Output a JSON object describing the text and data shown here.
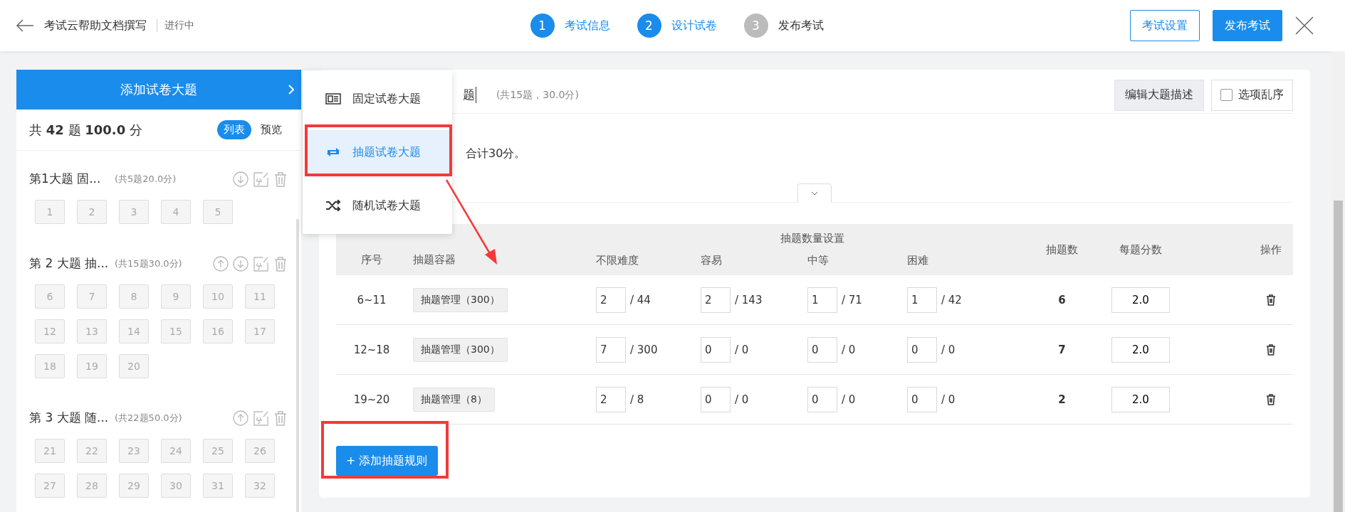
{
  "header": {
    "title": "考试云帮助文档撰写",
    "status": "进行中",
    "steps": [
      {
        "number": "1",
        "label": "考试信息",
        "reached": true
      },
      {
        "number": "2",
        "label": "设计试卷",
        "reached": true
      },
      {
        "number": "3",
        "label": "发布考试",
        "reached": false
      }
    ],
    "buttons": [
      {
        "label": "考试设置",
        "kind": "outline"
      },
      {
        "label": "发布考试",
        "kind": "primary"
      }
    ]
  },
  "sidebar": {
    "add_label": "添加试卷大题",
    "summary": "共 **42** 题 **100.0** 分",
    "view_tabs": [
      {
        "label": "列表",
        "selected": true
      },
      {
        "label": "预览",
        "selected": false
      }
    ],
    "sections": [
      {
        "title": "第1大题 固...",
        "info": "(共5题20.0分)",
        "actions": [
          {
            "kind": "down"
          },
          {
            "kind": "edit"
          },
          {
            "kind": "delete"
          }
        ],
        "questions": [
          "1",
          "2",
          "3",
          "4",
          "5"
        ]
      },
      {
        "title": "第 2 大题 抽...",
        "info": "(共15题30.0分)",
        "actions": [
          {
            "kind": "up"
          },
          {
            "kind": "down"
          },
          {
            "kind": "edit"
          },
          {
            "kind": "delete"
          }
        ],
        "questions": [
          "6",
          "7",
          "8",
          "9",
          "10",
          "11",
          "12",
          "13",
          "14",
          "15",
          "16",
          "17",
          "18",
          "19",
          "20"
        ]
      },
      {
        "title": "第 3 大题 随...",
        "info": "(共22题50.0分)",
        "actions": [
          {
            "kind": "up"
          },
          {
            "kind": "edit"
          },
          {
            "kind": "delete"
          }
        ],
        "questions": [
          "21",
          "22",
          "23",
          "24",
          "25",
          "26",
          "27",
          "28",
          "29",
          "30",
          "31",
          "32"
        ]
      }
    ]
  },
  "menu": {
    "items": [
      {
        "label": "固定试卷大题",
        "kind": "fixed",
        "selected": false
      },
      {
        "label": "抽题试卷大题",
        "kind": "draw",
        "selected": true
      },
      {
        "label": "随机试卷大题",
        "kind": "random",
        "selected": false
      }
    ]
  },
  "section_editor": {
    "title": "题",
    "info": "(共15题，30.0分)",
    "buttons": [
      "编辑大题描述"
    ],
    "shuffle": {
      "label": "选项乱序",
      "checked": false
    },
    "description": "合计30分。",
    "details_expanded": false,
    "table": {
      "columns": [
        "序号",
        "抽题容器"
      ],
      "group_heading": "抽题数量设置",
      "group_columns": [
        "不限难度",
        "容易",
        "中等",
        "困难"
      ],
      "columns_after": [
        "抽题数",
        "每题分数",
        "操作"
      ],
      "rows": [
        {
          "range": "6~11",
          "container": "抽题管理（300）",
          "counts": [
            {
              "value": "2",
              "total": "/ 44"
            },
            {
              "value": "2",
              "total": "/ 143"
            },
            {
              "value": "1",
              "total": "/ 71"
            },
            {
              "value": "1",
              "total": "/ 42"
            }
          ],
          "drawn": "6",
          "score": "2.0"
        },
        {
          "range": "12~18",
          "container": "抽题管理（300）",
          "counts": [
            {
              "value": "7",
              "total": "/ 300"
            },
            {
              "value": "0",
              "total": "/ 0"
            },
            {
              "value": "0",
              "total": "/ 0"
            },
            {
              "value": "0",
              "total": "/ 0"
            }
          ],
          "drawn": "7",
          "score": "2.0"
        },
        {
          "range": "19~20",
          "container": "抽题管理（8）",
          "counts": [
            {
              "value": "2",
              "total": "/ 8"
            },
            {
              "value": "0",
              "total": "/ 0"
            },
            {
              "value": "0",
              "total": "/ 0"
            },
            {
              "value": "0",
              "total": "/ 0"
            }
          ],
          "drawn": "2",
          "score": "2.0"
        }
      ]
    },
    "add_rule": "+ 添加抽题规则"
  }
}
